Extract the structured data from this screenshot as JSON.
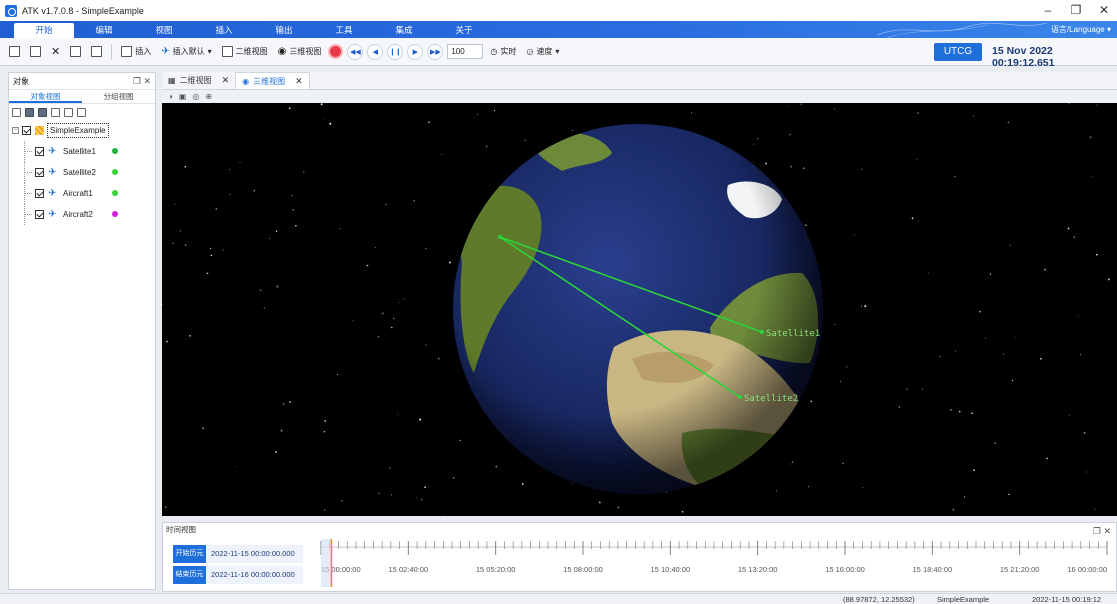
{
  "window": {
    "title": "ATK v1.7.0.8 - SimpleExample",
    "minimize": "–",
    "restore": "❐",
    "close": "✕"
  },
  "menu": {
    "items": [
      "开始",
      "编辑",
      "视图",
      "插入",
      "输出",
      "工具",
      "集成",
      "关于"
    ],
    "active_index": 0,
    "language": "语言/Language ▾"
  },
  "toolbar": {
    "insert": "插入",
    "insert_default": "插入默认",
    "view2d": "二维视图",
    "view3d": "三维视图",
    "speed": "100",
    "realtime": "实时",
    "speed_label": "速度",
    "time_system": "UTCG",
    "current_time": "15 Nov 2022 00:19:12.651"
  },
  "left_panel": {
    "title": "对象",
    "tabs": [
      "对象视图",
      "分组视图"
    ],
    "root": "SimpleExample",
    "objects": [
      {
        "label": "Satellite1",
        "kind": "satellite",
        "color": "#22b33a"
      },
      {
        "label": "Satellite2",
        "kind": "satellite",
        "color": "#37d13a"
      },
      {
        "label": "Aircraft1",
        "kind": "aircraft",
        "color": "#37d13a"
      },
      {
        "label": "Aircraft2",
        "kind": "aircraft",
        "color": "#d21ed6"
      }
    ]
  },
  "view_tabs": [
    {
      "label": "二维视图",
      "active": false
    },
    {
      "label": "三维视图",
      "active": true
    }
  ],
  "scene": {
    "labels": [
      "Satellite1",
      "Satellite2"
    ],
    "link_color": "#2bd43a"
  },
  "timeline": {
    "title": "时间视图",
    "start_label": "开始历元",
    "start_value": "2022-11-15 00:00:00.000",
    "end_label": "结束历元",
    "end_value": "2022-11-16 00:00:00.000",
    "ticks": [
      "15 00:00:00",
      "15 02:40:00",
      "15 05:20:00",
      "15 08:00:00",
      "15 10:40:00",
      "15 13:20:00",
      "15 16:00:00",
      "15 18:40:00",
      "15 21:20:00",
      "16 00:00:00"
    ],
    "current_fraction": 0.0133
  },
  "status": {
    "coords": "(88.97872, 12.25532)",
    "scenario": "SimpleExample",
    "time": "2022-11-15 00:19:12"
  }
}
